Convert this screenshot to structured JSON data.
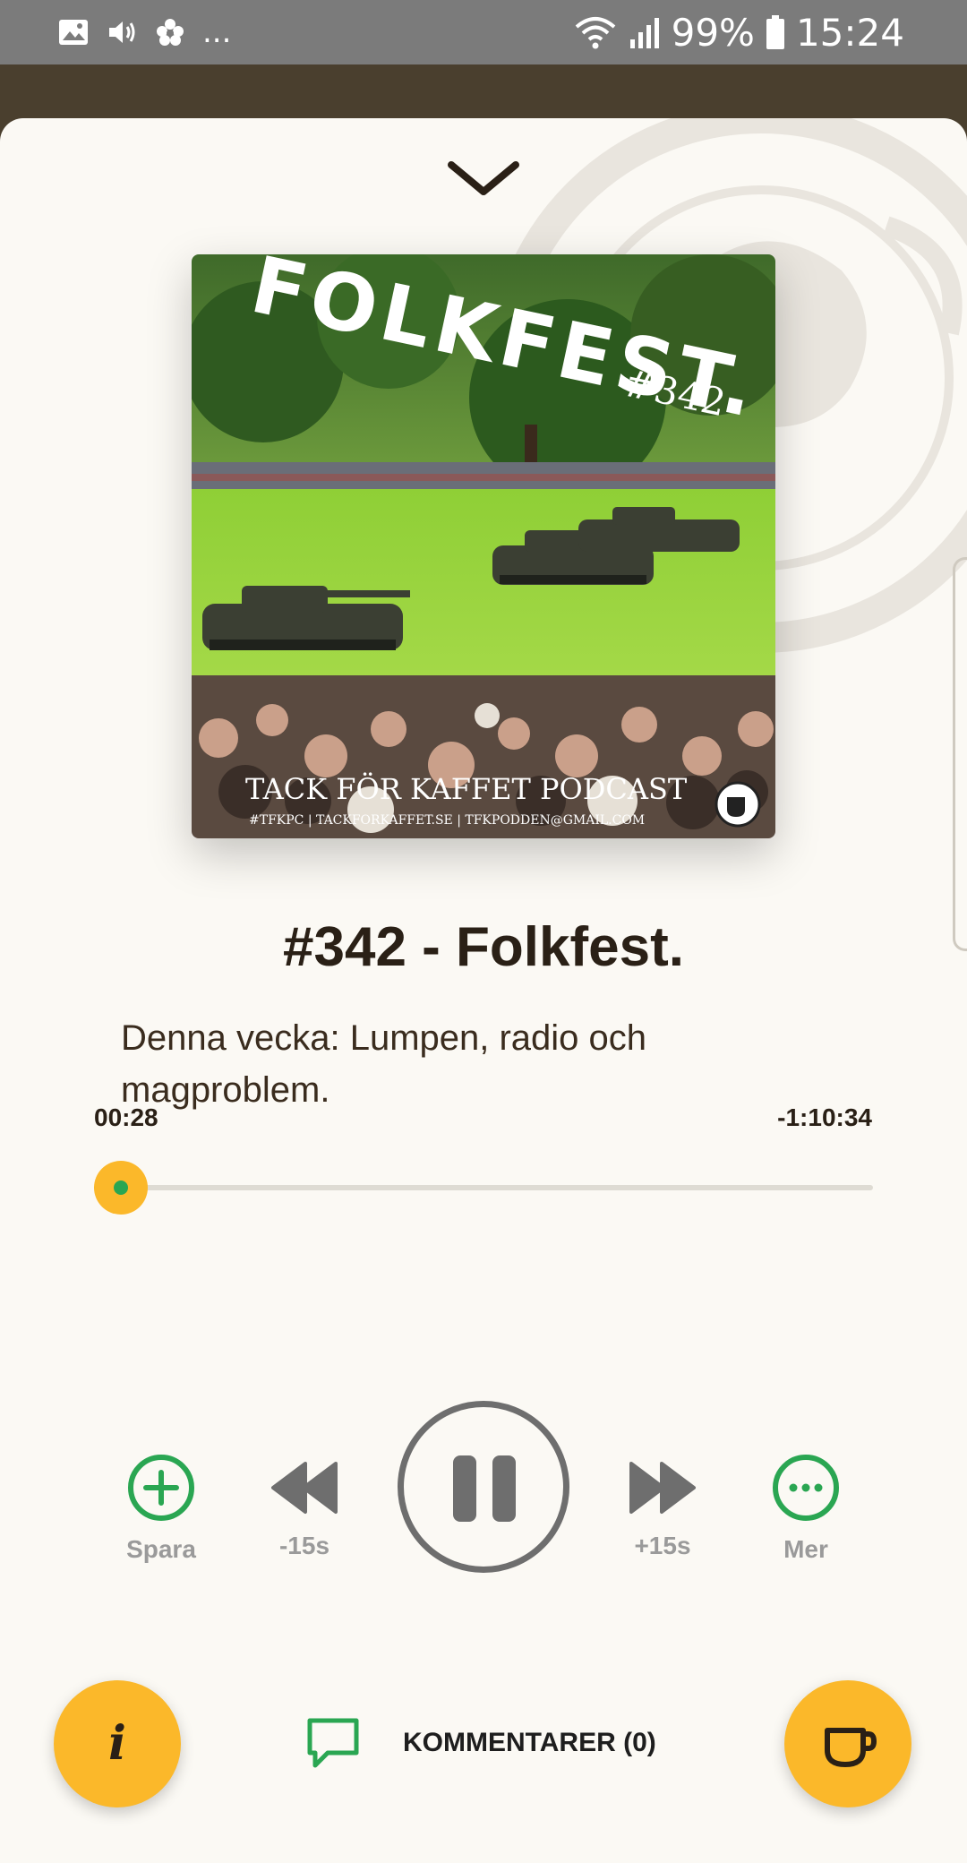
{
  "status_bar": {
    "left_icons": [
      "image-icon",
      "volume-icon",
      "flower-icon"
    ],
    "more": "...",
    "battery": "99%",
    "time": "15:24",
    "right_icons": [
      "wifi-icon",
      "signal-icon",
      "battery-icon"
    ]
  },
  "episode": {
    "title": "#342 - Folkfest.",
    "description": "Denna vecka: Lumpen, radio och magproblem."
  },
  "artwork": {
    "headline": "FOLKFEST.",
    "number": "#342",
    "footer_title": "TACK FÖR KAFFET PODCAST",
    "footer_sub": "#TFKPC | TACKFORKAFFET.SE | TFKPODDEN@GMAIL.COM"
  },
  "player": {
    "elapsed": "00:28",
    "remaining": "-1:10:34",
    "progress": 0.034
  },
  "controls": {
    "save_label": "Spara",
    "rewind_label": "-15s",
    "forward_label": "+15s",
    "more_label": "Mer",
    "state": "playing"
  },
  "bottom": {
    "comments_label": "KOMMENTARER (0)"
  },
  "colors": {
    "accent_yellow": "#fbb82a",
    "accent_green": "#2aa652",
    "sheet_bg": "#fbf9f4",
    "header_brown": "#4a3f2e"
  }
}
